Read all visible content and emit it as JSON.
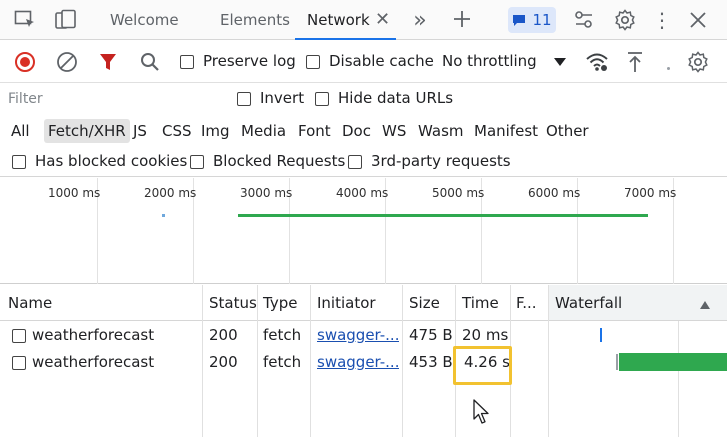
{
  "tabs": [
    {
      "label": "Welcome"
    },
    {
      "label": "Elements"
    },
    {
      "label": "Network"
    }
  ],
  "issues_count": "11",
  "toolbar": {
    "preserve_log": "Preserve log",
    "disable_cache": "Disable cache",
    "throttling": "No throttling"
  },
  "filter": {
    "placeholder": "Filter",
    "invert": "Invert",
    "hide_data_urls": "Hide data URLs"
  },
  "types": [
    "All",
    "Fetch/XHR",
    "JS",
    "CSS",
    "Img",
    "Media",
    "Font",
    "Doc",
    "WS",
    "Wasm",
    "Manifest",
    "Other"
  ],
  "selected_type": "Fetch/XHR",
  "blocked": {
    "has_blocked_cookies": "Has blocked cookies",
    "blocked_requests": "Blocked Requests",
    "third_party": "3rd-party requests"
  },
  "overview": {
    "ticks": [
      "1000 ms",
      "2000 ms",
      "3000 ms",
      "4000 ms",
      "5000 ms",
      "6000 ms",
      "7000 ms"
    ]
  },
  "table": {
    "columns": [
      "Name",
      "Status",
      "Type",
      "Initiator",
      "Size",
      "Time",
      "F...",
      "Waterfall"
    ],
    "rows": [
      {
        "name": "weatherforecast",
        "status": "200",
        "type": "fetch",
        "initiator": "swagger-...",
        "size": "475 B",
        "time": "20 ms"
      },
      {
        "name": "weatherforecast",
        "status": "200",
        "type": "fetch",
        "initiator": "swagger-...",
        "size": "453 B",
        "time": "4.26 s"
      }
    ]
  },
  "colors": {
    "accent": "#1a73e8",
    "record": "#d93025",
    "filter_active": "#c5221f",
    "waterfall_green": "#2fa84f",
    "highlight": "#f2c230"
  }
}
